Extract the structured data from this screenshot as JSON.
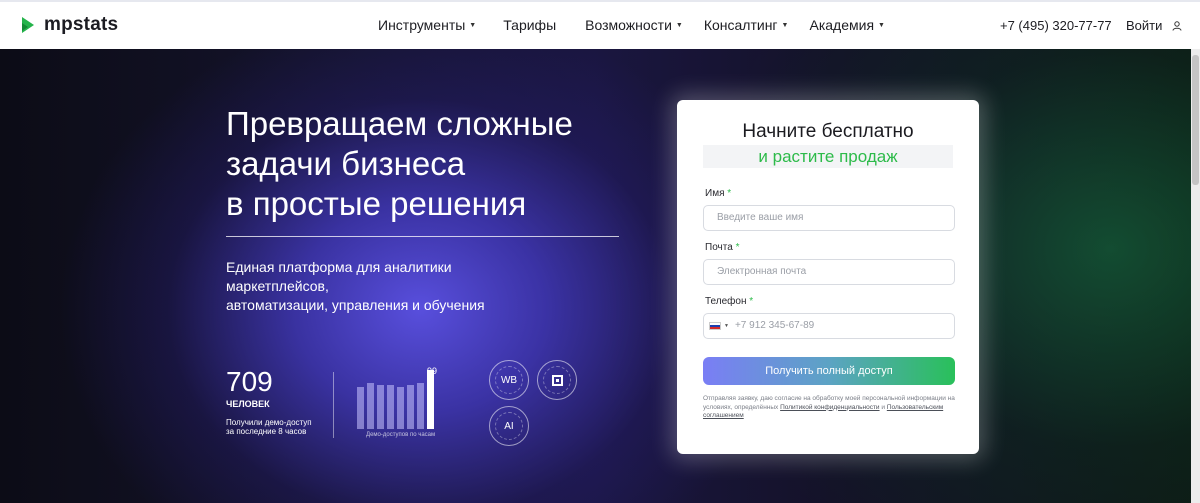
{
  "header": {
    "logo_text": "mpstats",
    "nav": [
      {
        "label": "Инструменты",
        "dropdown": true
      },
      {
        "label": "Тарифы",
        "dropdown": false
      },
      {
        "label": "Возможности",
        "dropdown": true
      },
      {
        "label": "Консалтинг",
        "dropdown": true
      },
      {
        "label": "Академия",
        "dropdown": true
      }
    ],
    "phone": "+7 (495) 320-77-77",
    "login": "Войти"
  },
  "hero": {
    "title_lines": [
      "Превращаем сложные",
      "задачи бизнеса",
      "в простые решения"
    ],
    "subtitle_lines": [
      "Единая платформа для аналитики маркетплейсов,",
      "автоматизации, управления и обучения"
    ],
    "stat": {
      "number": "709",
      "unit": "ЧЕЛОВЕК",
      "caption_lines": [
        "Получили демо-доступ",
        "за последние 8 часов"
      ]
    },
    "bars_chart": {
      "values": [
        70,
        76,
        73,
        73,
        70,
        73,
        76,
        99
      ],
      "peak_label": "99",
      "caption": "Демо-доступов по часам"
    },
    "seals": {
      "wb": "WB",
      "ai": "AI"
    }
  },
  "form": {
    "title": "Начните бесплатно",
    "subtitle": "и растите продаж",
    "name": {
      "label": "Имя",
      "required": "*",
      "placeholder": "Введите ваше имя"
    },
    "email": {
      "label": "Почта",
      "required": "*",
      "placeholder": "Электронная почта"
    },
    "phone": {
      "label": "Телефон",
      "required": "*",
      "placeholder": "+7 912 345-67-89"
    },
    "submit": "Получить полный доступ",
    "consent": {
      "text": "Отправляя заявку, даю согласие на обработку моей персональной информации на условиях, определённых ",
      "link1": "Политикой конфиденциальности",
      "and": " и ",
      "link2": "Пользовательским соглашением"
    }
  },
  "colors": {
    "accent_green": "#2dbb4a",
    "cta_gradient_start": "#7a7ef5",
    "cta_gradient_end": "#29c05a"
  }
}
